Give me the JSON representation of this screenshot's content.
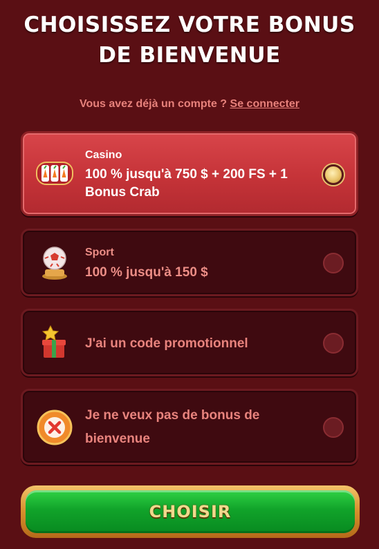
{
  "header": {
    "title_line1": "Choisissez votre bonus",
    "title_line2": "de bienvenue"
  },
  "login": {
    "prompt": "Vous avez déjà un compte ?",
    "link_label": "Se connecter"
  },
  "options": [
    {
      "category": "Casino",
      "text_line1": "100 % jusqu'à 750 $ + 200 FS + 1",
      "text_line2": "Bonus Crab",
      "icon": "slot-machine-icon",
      "selected": true
    },
    {
      "category": "Sport",
      "text_line1": "100 % jusqu'à 150 $",
      "icon": "soccer-ball-trophy-icon",
      "selected": false
    },
    {
      "text_line1": "J'ai un code promotionnel",
      "icon": "gift-box-star-icon",
      "selected": false
    },
    {
      "text_line1": "Je ne veux pas de bonus de",
      "text_line2": "bienvenue",
      "icon": "no-bonus-chip-icon",
      "selected": false
    }
  ],
  "submit": {
    "label": "Choisir"
  },
  "colors": {
    "background": "#5a0f14",
    "card": "#3f0a10",
    "selected_card": "#c53338",
    "accent_text": "#e7817b",
    "button_green": "#11a32a",
    "button_gold": "#d58f2c"
  }
}
